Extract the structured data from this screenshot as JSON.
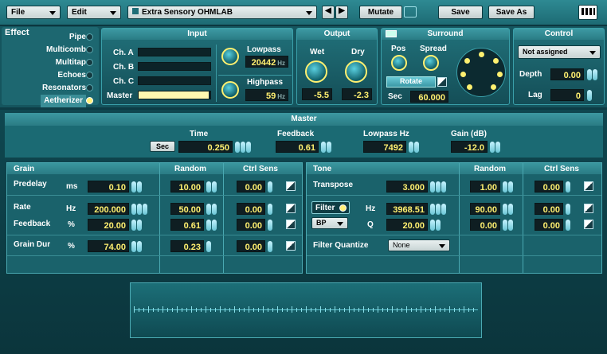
{
  "topbar": {
    "file": "File",
    "edit": "Edit",
    "preset": "Extra Sensory OHMLAB",
    "mutate": "Mutate",
    "save": "Save",
    "save_as": "Save As"
  },
  "effect": {
    "title": "Effect",
    "items": [
      {
        "label": "Pipe",
        "on": false
      },
      {
        "label": "Multicomb",
        "on": false
      },
      {
        "label": "Multitap",
        "on": false
      },
      {
        "label": "Echoes",
        "on": false
      },
      {
        "label": "Resonators",
        "on": false
      },
      {
        "label": "Aetherizer",
        "on": true
      }
    ]
  },
  "input": {
    "title": "Input",
    "ch_a": "Ch. A",
    "ch_b": "Ch. B",
    "ch_c": "Ch. C",
    "master": "Master",
    "master_level": 0.98,
    "lowpass_label": "Lowpass",
    "lowpass_value": "20442",
    "lowpass_unit": "Hz",
    "highpass_label": "Highpass",
    "highpass_value": "59",
    "highpass_unit": "Hz"
  },
  "output": {
    "title": "Output",
    "wet_label": "Wet",
    "dry_label": "Dry",
    "wet_value": "-5.5",
    "dry_value": "-2.3"
  },
  "surround": {
    "title": "Surround",
    "pos_label": "Pos",
    "spread_label": "Spread",
    "rotate": "Rotate",
    "sec_label": "Sec",
    "sec_value": "60.000"
  },
  "control": {
    "title": "Control",
    "assign": "Not assigned",
    "depth_label": "Depth",
    "depth_value": "0.00",
    "lag_label": "Lag",
    "lag_value": "0"
  },
  "master": {
    "title": "Master",
    "sec_btn": "Sec",
    "time_label": "Time",
    "time_value": "0.250",
    "feedback_label": "Feedback",
    "feedback_value": "0.61",
    "lowpass_label": "Lowpass Hz",
    "lowpass_value": "7492",
    "gain_label": "Gain (dB)",
    "gain_value": "-12.0"
  },
  "grain": {
    "title": "Grain",
    "random": "Random",
    "ctrl": "Ctrl Sens",
    "predelay": {
      "label": "Predelay",
      "unit": "ms",
      "value": "0.10",
      "random": "10.00",
      "ctrl": "0.00"
    },
    "rate": {
      "label": "Rate",
      "unit": "Hz",
      "value": "200.000",
      "random": "50.00",
      "ctrl": "0.00"
    },
    "feedback": {
      "label": "Feedback",
      "unit": "%",
      "value": "20.00",
      "random": "0.61",
      "ctrl": "0.00"
    },
    "graindur": {
      "label": "Grain Dur",
      "unit": "%",
      "value": "74.00",
      "random": "0.23",
      "ctrl": "0.00"
    }
  },
  "tone": {
    "title": "Tone",
    "random": "Random",
    "ctrl": "Ctrl Sens",
    "transpose": {
      "label": "Transpose",
      "value": "3.000",
      "random": "1.00",
      "ctrl": "0.00"
    },
    "filter": {
      "label": "Filter",
      "type": "BP",
      "hz_unit": "Hz",
      "hz_value": "3968.51",
      "q_unit": "Q",
      "q_value": "20.00",
      "hz_random": "90.00",
      "q_random": "0.00",
      "hz_ctrl": "0.00",
      "q_ctrl": "0.00"
    },
    "quantize": {
      "label": "Filter Quantize",
      "value": "None"
    }
  },
  "colors": {
    "accent": "#fff070",
    "panel": "#1d6b74",
    "background": "#0d3c45"
  }
}
